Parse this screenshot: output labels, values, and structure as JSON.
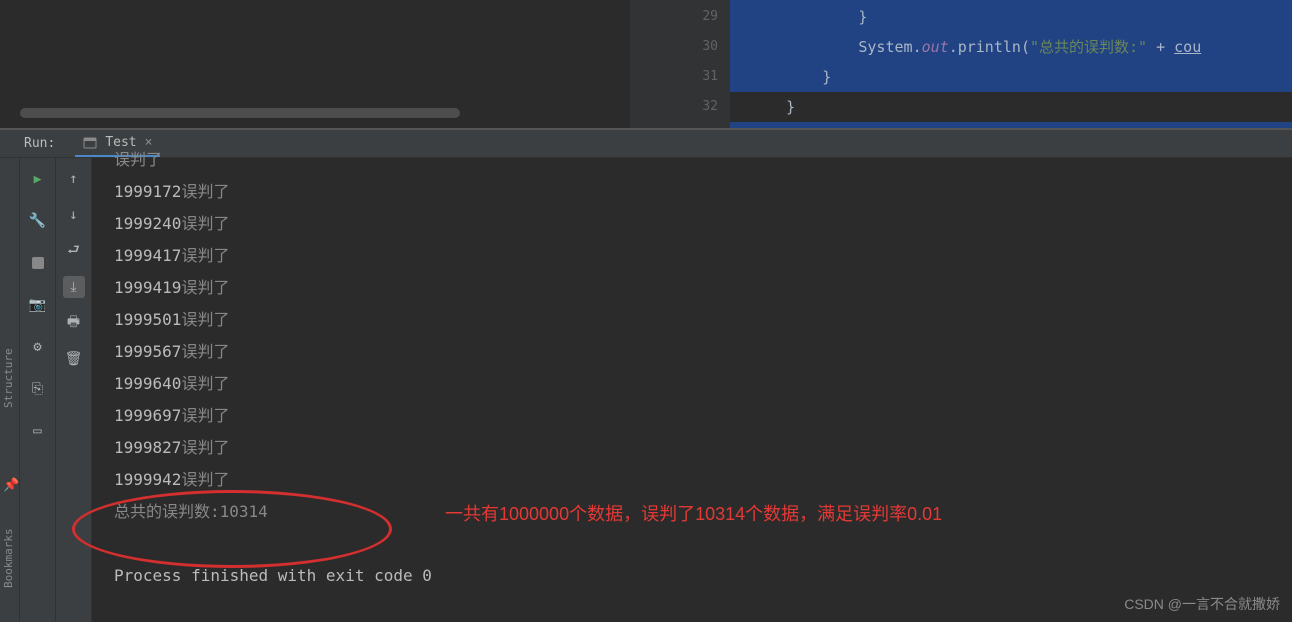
{
  "editor": {
    "lines": [
      {
        "num": "29",
        "indent": "            ",
        "content_brace": "}"
      },
      {
        "num": "30",
        "indent": "            ",
        "obj": "System",
        "dot1": ".",
        "field": "out",
        "dot2": ".",
        "method": "println",
        "paren": "(",
        "str": "\"总共的误判数:\"",
        "plus": " + ",
        "var": "cou"
      },
      {
        "num": "31",
        "indent": "        ",
        "content_brace": "}"
      },
      {
        "num": "32",
        "indent": "    ",
        "content_brace": "}",
        "last": true
      }
    ]
  },
  "run": {
    "label": "Run:",
    "tab_name": "Test",
    "close_glyph": "×"
  },
  "console": {
    "partial_top": "误判了",
    "lines": [
      {
        "num": "1999172",
        "txt": "误判了"
      },
      {
        "num": "1999240",
        "txt": "误判了"
      },
      {
        "num": "1999417",
        "txt": "误判了"
      },
      {
        "num": "1999419",
        "txt": "误判了"
      },
      {
        "num": "1999501",
        "txt": "误判了"
      },
      {
        "num": "1999567",
        "txt": "误判了"
      },
      {
        "num": "1999640",
        "txt": "误判了"
      },
      {
        "num": "1999697",
        "txt": "误判了"
      },
      {
        "num": "1999827",
        "txt": "误判了"
      },
      {
        "num": "1999942",
        "txt": "误判了"
      }
    ],
    "summary": "总共的误判数:10314",
    "exit": "Process finished with exit code 0"
  },
  "annotation": {
    "text": "一共有1000000个数据，误判了10314个数据，满足误判率0.01"
  },
  "sidebar": {
    "label1": "Structure",
    "label2": "Bookmarks"
  },
  "watermark": "CSDN @一言不合就撒娇"
}
